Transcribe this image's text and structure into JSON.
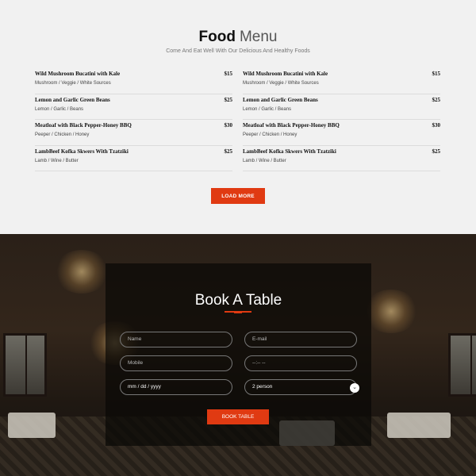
{
  "menu": {
    "title_bold": "Food",
    "title_light": "Menu",
    "subtitle": "Come And Eat Well With Our Delicious And Healthy Foods",
    "left_items": [
      {
        "name": "Wild Mushroom Bucatini with Kale",
        "price": "$15",
        "desc": "Mushroom / Veggie / White Sources"
      },
      {
        "name": "Lemon and Garlic Green Beans",
        "price": "$25",
        "desc": "Lemon / Garlic / Beans"
      },
      {
        "name": "Meatloaf with Black Pepper-Honey BBQ",
        "price": "$30",
        "desc": "Peeper / Chicken / Honey"
      },
      {
        "name": "LambBeef Kofka Skwers With Tzatziki",
        "price": "$25",
        "desc": "Lamb / Wine / Butter"
      }
    ],
    "right_items": [
      {
        "name": "Wild Mushroom Bucatini with Kale",
        "price": "$15",
        "desc": "Mushroom / Veggie / White Sources"
      },
      {
        "name": "Lemon and Garlic Green Beans",
        "price": "$25",
        "desc": "Lemon / Garlic / Beans"
      },
      {
        "name": "Meatloaf with Black Pepper-Honey BBQ",
        "price": "$30",
        "desc": "Peeper / Chicken / Honey"
      },
      {
        "name": "LambBeef Kofka Skwers With Tzatziki",
        "price": "$25",
        "desc": "Lamb / Wine / Butter"
      }
    ],
    "load_more_label": "LOAD MORE"
  },
  "booking": {
    "title": "Book A Table",
    "name_placeholder": "Name",
    "email_placeholder": "E-mail",
    "mobile_placeholder": "Mobile",
    "time_placeholder": "--:-- --",
    "date_placeholder": "mm / dd / yyyy",
    "guests_value": "2 person",
    "submit_label": "BOOK TABLE"
  },
  "colors": {
    "accent": "#e03a12",
    "menu_background": "#f1f1f1"
  }
}
